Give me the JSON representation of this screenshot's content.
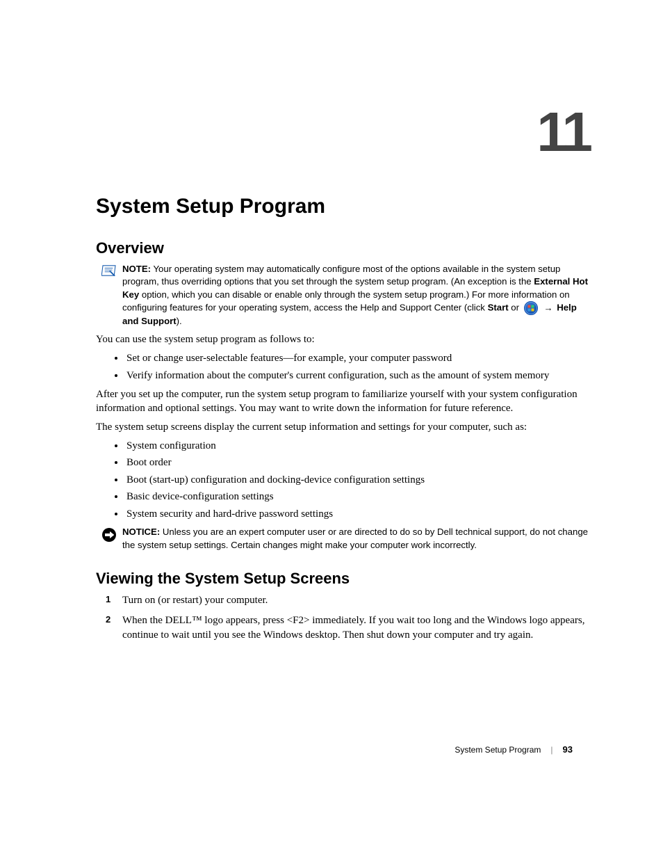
{
  "chapter_number": "11",
  "title": "System Setup Program",
  "section_overview": "Overview",
  "note": {
    "label": "NOTE:",
    "t1": " Your operating system may automatically configure most of the options available in the system setup program, thus overriding options that you set through the system setup program. (An exception is the ",
    "b1": "External Hot Key",
    "t2": " option, which you can disable or enable only through the system setup program.) For more information on configuring features for your operating system, access the Help and Support Center (click ",
    "b2": "Start",
    "t3": " or ",
    "arrow": "→",
    "b3": "Help and Support",
    "t4": ")."
  },
  "p_intro": "You can use the system setup program as follows to:",
  "list1": {
    "i1": "Set or change user-selectable features—for example, your computer password",
    "i2": "Verify information about the computer's current configuration, such as the amount of system memory"
  },
  "p_after": "After you set up the computer, run the system setup program to familiarize yourself with your system configuration information and optional settings. You may want to write down the information for future reference.",
  "p_screens": "The system setup screens display the current setup information and settings for your computer, such as:",
  "list2": {
    "i1": "System configuration",
    "i2": "Boot order",
    "i3": "Boot (start-up) configuration and docking-device configuration settings",
    "i4": "Basic device-configuration settings",
    "i5": "System security and hard-drive password settings"
  },
  "notice": {
    "label": "NOTICE:",
    "text": " Unless you are an expert computer user or are directed to do so by Dell technical support, do not change the system setup settings. Certain changes might make your computer work incorrectly."
  },
  "section_viewing": "Viewing the System Setup Screens",
  "steps": {
    "s1": "Turn on (or restart) your computer.",
    "s2": "When the DELL™ logo appears, press <F2> immediately. If you wait too long and the Windows logo appears, continue to wait until you see the Windows desktop. Then shut down your computer and try again."
  },
  "footer": {
    "section": "System Setup Program",
    "page": "93"
  }
}
